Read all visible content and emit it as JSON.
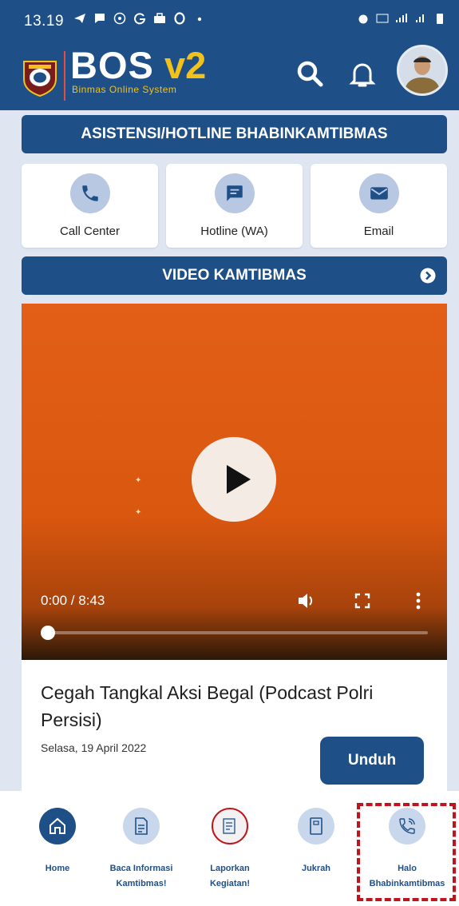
{
  "status_bar": {
    "time": "13.19"
  },
  "app": {
    "brand_main": "BOS",
    "brand_version": "v2",
    "brand_subtitle": "Binmas Online System"
  },
  "hotline_banner": {
    "title": "ASISTENSI/HOTLINE BHABINKAMTIBMAS"
  },
  "contact_cards": [
    {
      "label": "Call Center",
      "icon": "phone-icon"
    },
    {
      "label": "Hotline (WA)",
      "icon": "chat-icon"
    },
    {
      "label": "Email",
      "icon": "mail-icon"
    }
  ],
  "video_banner": {
    "title": "VIDEO KAMTIBMAS"
  },
  "video": {
    "time_display": "0:00 / 8:43",
    "progress": 0,
    "title": "Cegah Tangkal Aksi Begal (Podcast Polri Persisi)",
    "date": "Selasa, 19 April 2022",
    "download_label": "Unduh"
  },
  "bottom_nav": [
    {
      "label": "Home",
      "icon": "home-icon",
      "active": true
    },
    {
      "label": "Baca Informasi Kamtibmas!",
      "icon": "document-icon",
      "active": false
    },
    {
      "label": "Laporkan Kegiatan!",
      "icon": "report-icon",
      "active": false
    },
    {
      "label": "Jukrah",
      "icon": "book-icon",
      "active": false
    },
    {
      "label": "Halo Bhabinkamtibmas",
      "icon": "phone-call-icon",
      "active": false
    }
  ],
  "colors": {
    "primary": "#1f4f87",
    "accent": "#f3c21a",
    "highlight": "#c0141c",
    "video_bg": "#e35f18"
  }
}
